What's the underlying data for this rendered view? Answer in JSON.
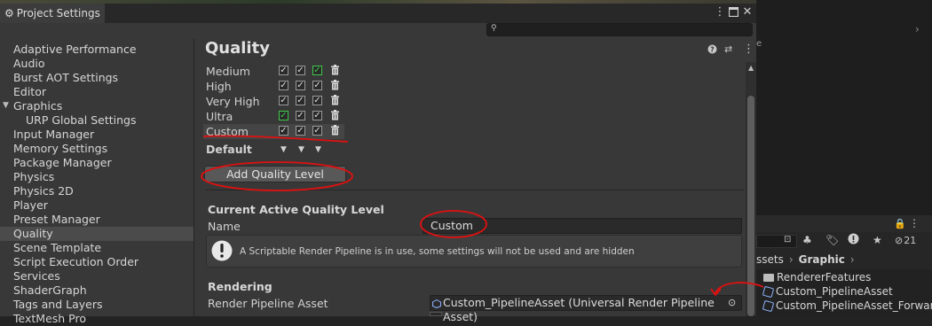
{
  "window": {
    "title": "Project Settings",
    "title_icon": "gear-icon",
    "menu_icon": "kebab-icon",
    "maximize_icon": "maximize-icon",
    "close_icon": "close-icon"
  },
  "search": {
    "icon": "search-icon",
    "value": ""
  },
  "sidebar": {
    "items": [
      {
        "label": "Adaptive Performance"
      },
      {
        "label": "Audio"
      },
      {
        "label": "Burst AOT Settings"
      },
      {
        "label": "Editor"
      },
      {
        "label": "Graphics"
      },
      {
        "label": "URP Global Settings"
      },
      {
        "label": "Input Manager"
      },
      {
        "label": "Memory Settings"
      },
      {
        "label": "Package Manager"
      },
      {
        "label": "Physics"
      },
      {
        "label": "Physics 2D"
      },
      {
        "label": "Player"
      },
      {
        "label": "Preset Manager"
      },
      {
        "label": "Quality"
      },
      {
        "label": "Scene Template"
      },
      {
        "label": "Script Execution Order"
      },
      {
        "label": "Services"
      },
      {
        "label": "ShaderGraph"
      },
      {
        "label": "Tags and Layers"
      },
      {
        "label": "TextMesh Pro"
      }
    ],
    "selected": "Quality"
  },
  "quality": {
    "title": "Quality",
    "header_icons": [
      "help-icon",
      "presets-icon",
      "kebab-icon"
    ],
    "levels": [
      {
        "name": "Medium",
        "checks": [
          true,
          true,
          true
        ],
        "green": [
          false,
          false,
          true
        ]
      },
      {
        "name": "High",
        "checks": [
          true,
          true,
          true
        ],
        "green": [
          false,
          false,
          false
        ]
      },
      {
        "name": "Very High",
        "checks": [
          true,
          true,
          true
        ],
        "green": [
          false,
          false,
          false
        ]
      },
      {
        "name": "Ultra",
        "checks": [
          true,
          true,
          true
        ],
        "green": [
          true,
          false,
          false
        ]
      },
      {
        "name": "Custom",
        "checks": [
          true,
          true,
          true
        ],
        "green": [
          false,
          false,
          false
        ]
      }
    ],
    "default_label": "Default",
    "add_button": "Add Quality Level",
    "current_section": "Current Active Quality Level",
    "name_label": "Name",
    "name_value": "Custom",
    "info_text": "A Scriptable Render Pipeline is in use, some settings will not be used and are hidden",
    "rendering_section": "Rendering",
    "pipeline_label": "Render Pipeline Asset",
    "pipeline_value": "Custom_PipelineAsset (Universal Render Pipeline Asset)"
  },
  "project_panel": {
    "hidden_count": "21",
    "breadcrumb": [
      "ssets",
      "Graphic"
    ],
    "items": [
      {
        "label": "RendererFeatures",
        "icon": "folder-icon"
      },
      {
        "label": "Custom_PipelineAsset",
        "icon": "asset-icon"
      },
      {
        "label": "Custom_PipelineAsset_Forwar",
        "icon": "asset-icon"
      }
    ],
    "colors": {
      "annotation": "#e01010",
      "selection": "#4b4b4b",
      "check_green": "#3fc84a"
    }
  }
}
